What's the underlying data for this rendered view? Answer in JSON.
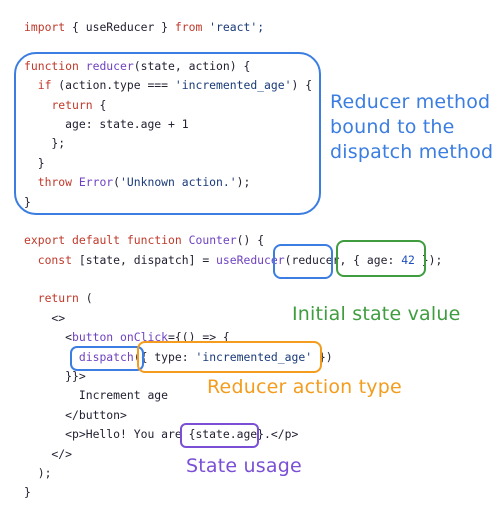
{
  "code_lines": [
    [
      {
        "t": "import",
        "c": "kw"
      },
      {
        "t": " { useReducer } ",
        "c": "plain"
      },
      {
        "t": "from",
        "c": "kw"
      },
      {
        "t": " 'react';",
        "c": "str"
      }
    ],
    [],
    [
      {
        "t": "function",
        "c": "kw"
      },
      {
        "t": " ",
        "c": "plain"
      },
      {
        "t": "reducer",
        "c": "fn"
      },
      {
        "t": "(state, action) {",
        "c": "plain"
      }
    ],
    [
      {
        "t": "  ",
        "c": "plain"
      },
      {
        "t": "if",
        "c": "kw"
      },
      {
        "t": " (action.type === ",
        "c": "plain"
      },
      {
        "t": "'incremented_age'",
        "c": "str"
      },
      {
        "t": ") {",
        "c": "plain"
      }
    ],
    [
      {
        "t": "    ",
        "c": "plain"
      },
      {
        "t": "return",
        "c": "kw"
      },
      {
        "t": " {",
        "c": "plain"
      }
    ],
    [
      {
        "t": "      age: state.age + 1",
        "c": "plain"
      }
    ],
    [
      {
        "t": "    };",
        "c": "plain"
      }
    ],
    [
      {
        "t": "  }",
        "c": "plain"
      }
    ],
    [
      {
        "t": "  ",
        "c": "plain"
      },
      {
        "t": "throw",
        "c": "kw"
      },
      {
        "t": " ",
        "c": "plain"
      },
      {
        "t": "Error",
        "c": "fn"
      },
      {
        "t": "(",
        "c": "plain"
      },
      {
        "t": "'Unknown action.'",
        "c": "str"
      },
      {
        "t": ");",
        "c": "plain"
      }
    ],
    [
      {
        "t": "}",
        "c": "plain"
      }
    ],
    [],
    [
      {
        "t": "export",
        "c": "kw"
      },
      {
        "t": " ",
        "c": "plain"
      },
      {
        "t": "default",
        "c": "kw"
      },
      {
        "t": " ",
        "c": "plain"
      },
      {
        "t": "function",
        "c": "kw"
      },
      {
        "t": " ",
        "c": "plain"
      },
      {
        "t": "Counter",
        "c": "fn"
      },
      {
        "t": "() {",
        "c": "plain"
      }
    ],
    [
      {
        "t": "  ",
        "c": "plain"
      },
      {
        "t": "const",
        "c": "kw"
      },
      {
        "t": " [state, dispatch] = ",
        "c": "plain"
      },
      {
        "t": "useReducer",
        "c": "fn"
      },
      {
        "t": "(reducer, { age: ",
        "c": "plain"
      },
      {
        "t": "42",
        "c": "num"
      },
      {
        "t": " });",
        "c": "plain"
      }
    ],
    [],
    [
      {
        "t": "  ",
        "c": "plain"
      },
      {
        "t": "return",
        "c": "kw"
      },
      {
        "t": " (",
        "c": "plain"
      }
    ],
    [
      {
        "t": "    <>",
        "c": "plain"
      }
    ],
    [
      {
        "t": "      <",
        "c": "plain"
      },
      {
        "t": "button",
        "c": "fn"
      },
      {
        "t": " ",
        "c": "plain"
      },
      {
        "t": "onClick",
        "c": "fn"
      },
      {
        "t": "={() => {",
        "c": "plain"
      }
    ],
    [
      {
        "t": "        ",
        "c": "plain"
      },
      {
        "t": "dispatch",
        "c": "fn"
      },
      {
        "t": "({ type: ",
        "c": "plain"
      },
      {
        "t": "'incremented_age'",
        "c": "str"
      },
      {
        "t": " })",
        "c": "plain"
      }
    ],
    [
      {
        "t": "      }}>",
        "c": "plain"
      }
    ],
    [
      {
        "t": "        Increment age",
        "c": "plain"
      }
    ],
    [
      {
        "t": "      </button>",
        "c": "plain"
      }
    ],
    [
      {
        "t": "      <p>Hello! You are {state.age}.</p>",
        "c": "plain"
      }
    ],
    [
      {
        "t": "    </>",
        "c": "plain"
      }
    ],
    [
      {
        "t": "  );",
        "c": "plain"
      }
    ],
    [
      {
        "t": "}",
        "c": "plain"
      }
    ]
  ],
  "annotations": {
    "reducer_method": "Reducer method\nbound to the\ndispatch method",
    "initial_state": "Initial state value",
    "reducer_action_type": "Reducer action type",
    "state_usage": "State usage"
  },
  "colors": {
    "blue": "#3b7de0",
    "green": "#3f9d3f",
    "orange": "#f39c1d",
    "purple": "#7a4fd6"
  }
}
